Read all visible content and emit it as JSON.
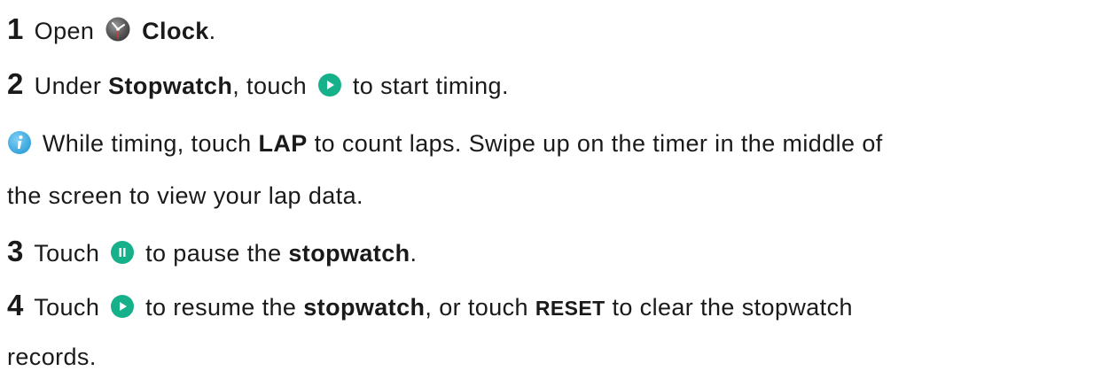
{
  "steps": [
    {
      "number": "1",
      "text_before": "Open",
      "icon": "clock-app-icon",
      "bold": "Clock",
      "text_after": "."
    },
    {
      "number": "2",
      "text_before": "Under",
      "bold": "Stopwatch",
      "text_mid": ", touch",
      "icon": "play-button-icon",
      "text_after": "to start timing."
    },
    {
      "number": "3",
      "text_before": "Touch",
      "icon": "pause-button-icon",
      "text_mid": "to pause the",
      "bold": "stopwatch",
      "text_after": "."
    },
    {
      "number": "4",
      "text_before": "Touch",
      "icon": "play-button-icon",
      "text_mid": "to resume the",
      "bold": "stopwatch",
      "text_mid2": ", or touch",
      "bold2": "RESET",
      "text_after_line1": "to clear the stopwatch",
      "text_after_line2": "records."
    }
  ],
  "tip": {
    "icon": "info-icon",
    "text_before": "While timing, touch",
    "bold": "LAP",
    "text_line1_after": "to count laps. Swipe up on the timer in the middle of",
    "text_line2": "the screen to view your lap data."
  },
  "colors": {
    "text": "#1a1a1a",
    "accent_green": "#16b08a",
    "info_blue": "#2e9fd8"
  }
}
